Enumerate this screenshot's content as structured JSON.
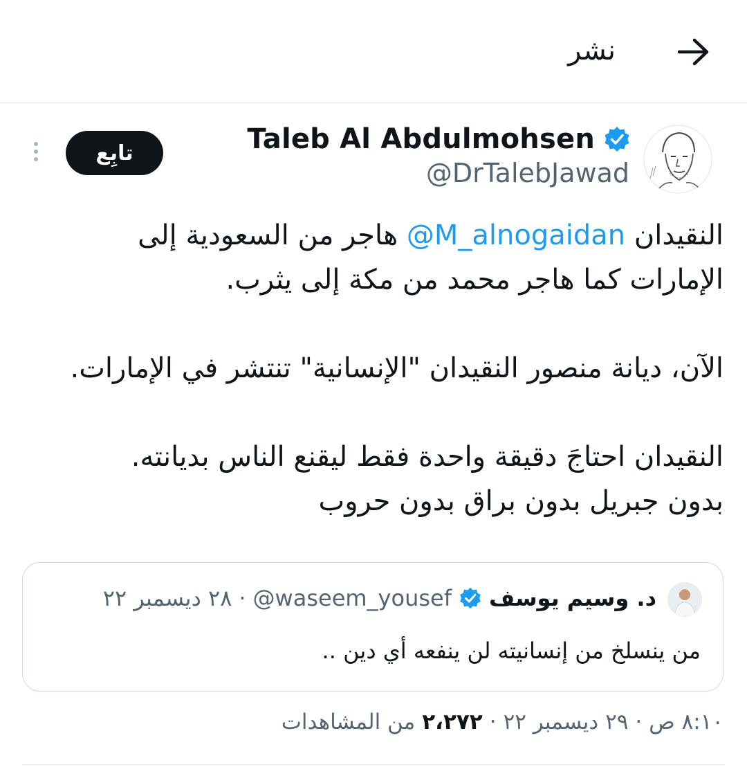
{
  "header": {
    "title": "نشر",
    "back_icon": "arrow-right-icon"
  },
  "author": {
    "display_name": "Taleb Al Abdulmohsen",
    "handle": "@DrTalebJawad",
    "verified": true,
    "follow_label": "تابِع"
  },
  "tweet": {
    "line1_before": "النقيدان ",
    "mention": "@M_alnogaidan",
    "line1_after": " هاجر من السعودية إلى",
    "line2": "الإمارات كما هاجر محمد من مكة إلى يثرب.",
    "para2": "الآن، ديانة منصور النقيدان \"الإنسانية\" تنتشر في الإمارات.",
    "para3_line1": "النقيدان احتاجَ دقيقة واحدة فقط ليقنع الناس بديانته.",
    "para3_line2": "بدون جبريل بدون براق بدون حروب"
  },
  "quote": {
    "name": "د. وسيم يوسف",
    "handle": "@waseem_yousef",
    "separator": "·",
    "date": "٢٨ ديسمبر ٢٢",
    "text": "من ينسلخ من إنسانيته لن ينفعه أي دين .."
  },
  "meta": {
    "time": "٨:١٠ ص",
    "sep1": "·",
    "date": "٢٩ ديسمبر ٢٢",
    "sep2": "·",
    "views_count": "٢،٢٧٢",
    "views_label": "من المشاهدات"
  },
  "colors": {
    "accent": "#1d9bf0",
    "text": "#0f1419",
    "muted": "#536471",
    "border": "#cfd9de"
  }
}
